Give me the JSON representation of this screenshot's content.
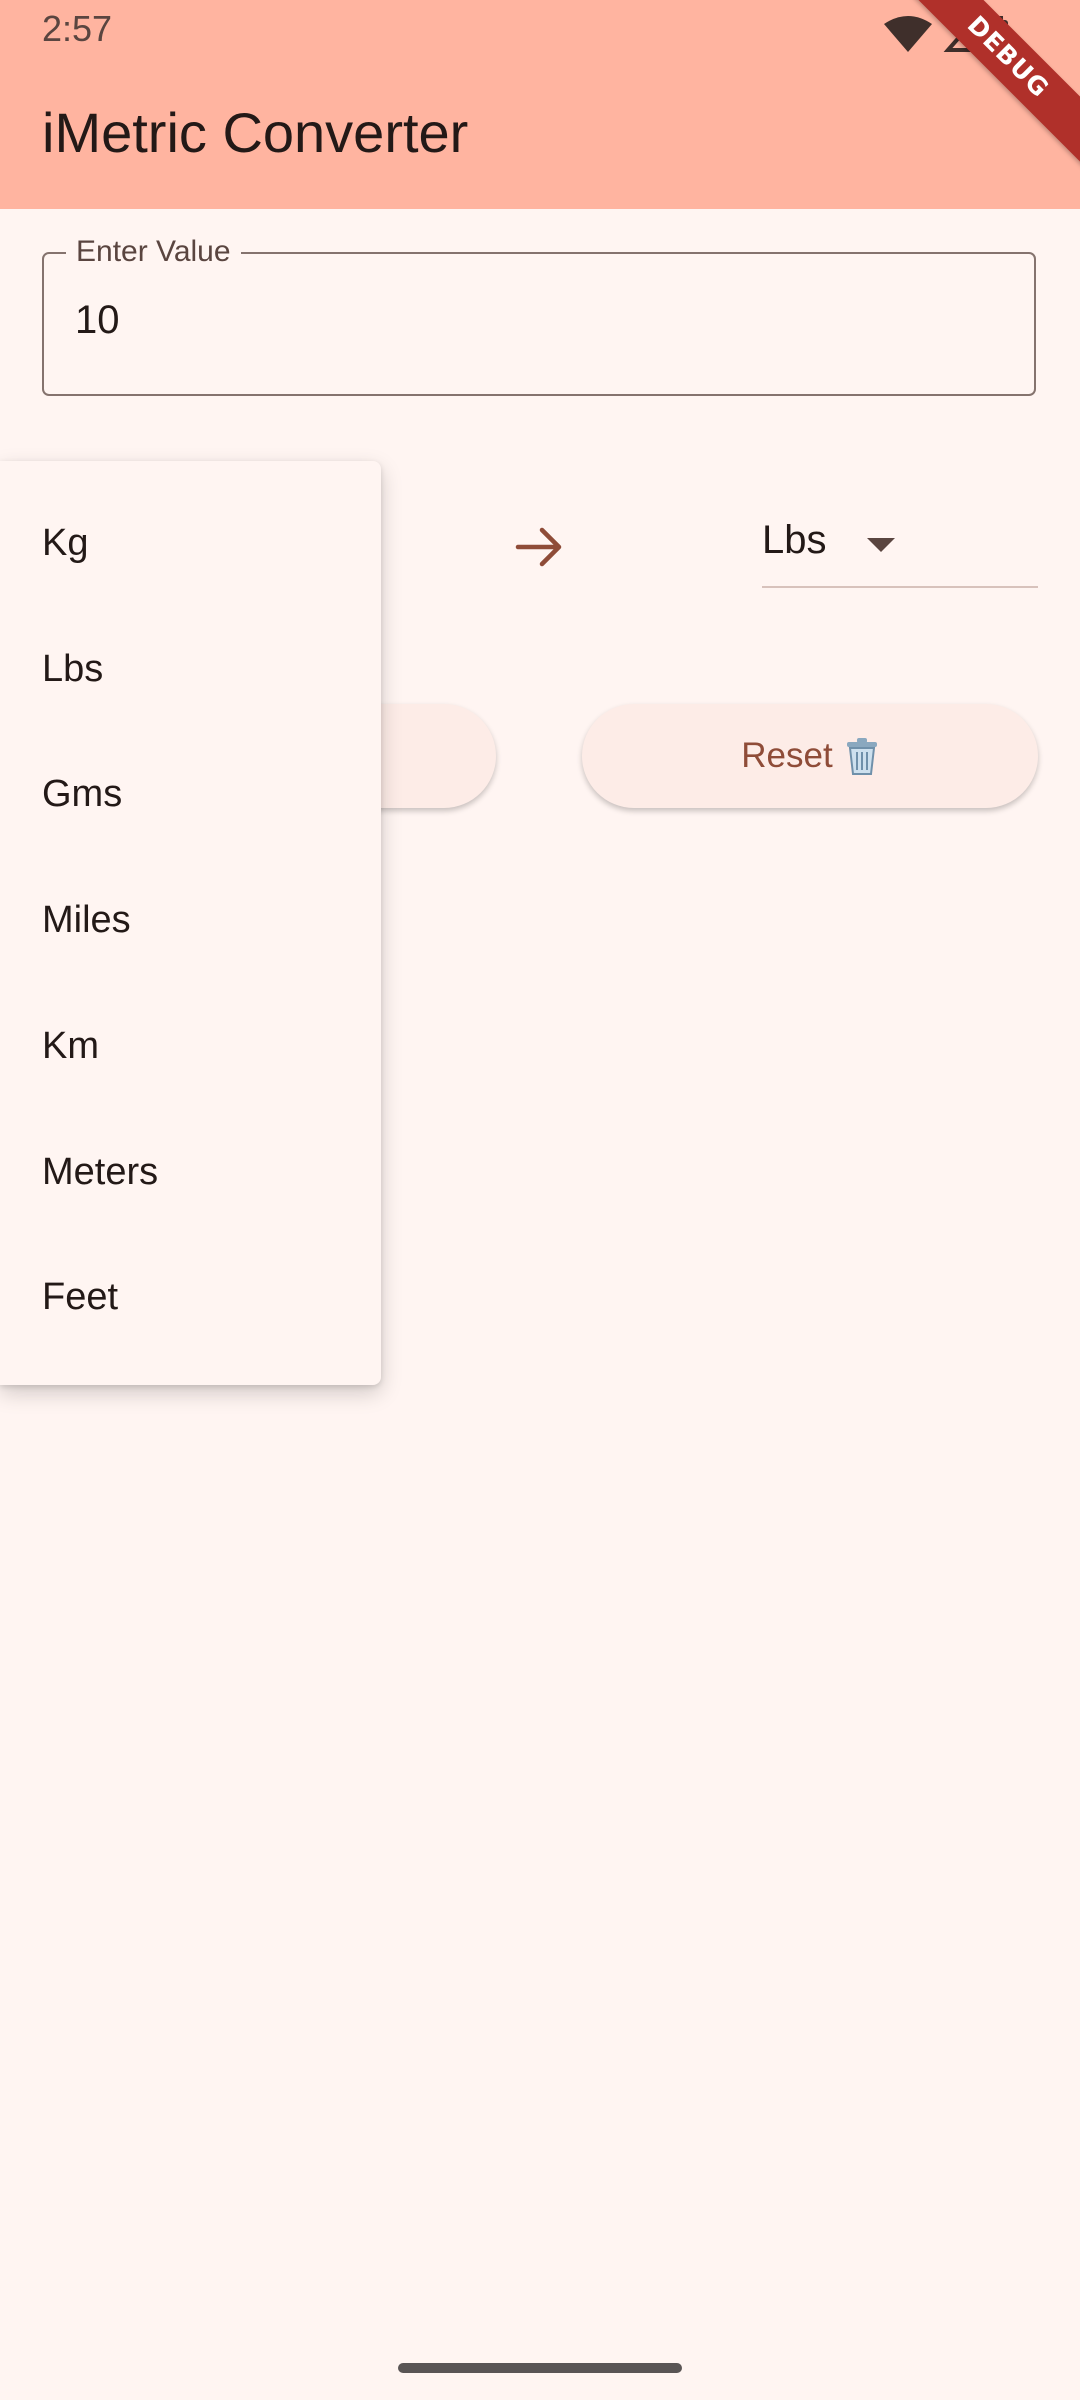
{
  "status_bar": {
    "time": "2:57",
    "debug_label": "DEBUG"
  },
  "app_bar": {
    "title": "iMetric Converter",
    "color": "#ffb4a0"
  },
  "value_field": {
    "label": "Enter Value",
    "value": "10"
  },
  "to_unit": {
    "selected": "Lbs"
  },
  "buttons": {
    "reset_label": "Reset"
  },
  "unit_menu": {
    "items": [
      "Kg",
      "Lbs",
      "Gms",
      "Miles",
      "Km",
      "Meters",
      "Feet"
    ]
  },
  "colors": {
    "background": "#fff5f2",
    "accent": "#8f4c38"
  }
}
